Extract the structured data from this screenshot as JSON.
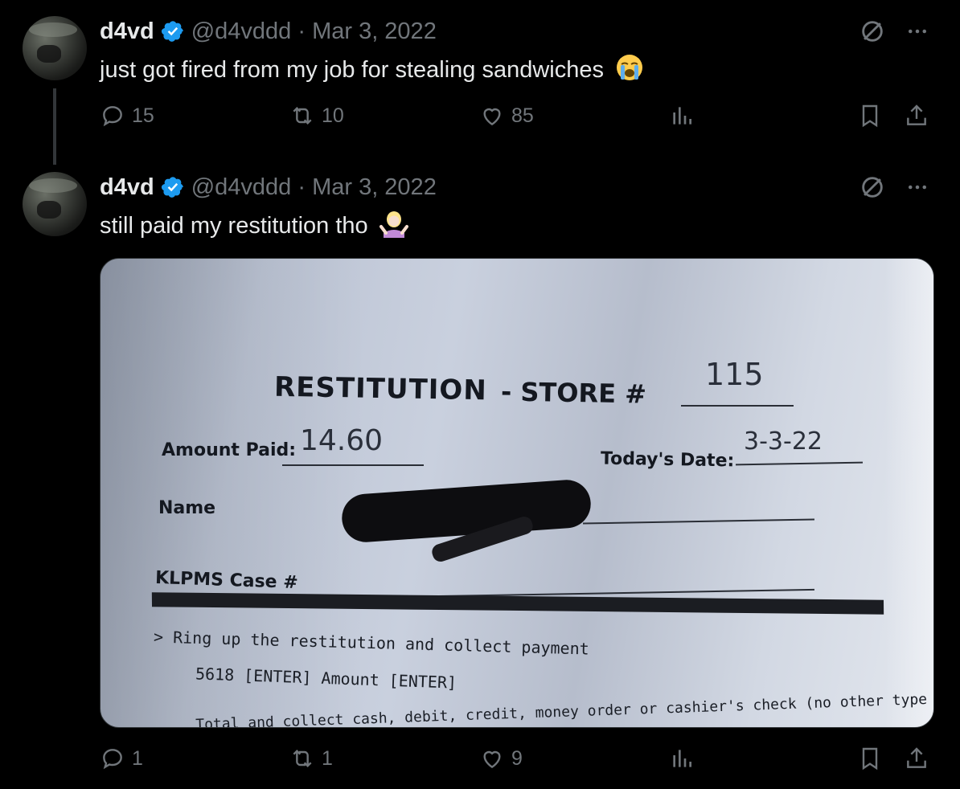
{
  "tweets": [
    {
      "author": {
        "name": "d4vd",
        "handle": "@d4vddd",
        "date": "Mar 3, 2022"
      },
      "text": "just got fired from my job for stealing sandwiches",
      "emoji": "loudly-crying-face",
      "stats": {
        "replies": "15",
        "reposts": "10",
        "likes": "85"
      }
    },
    {
      "author": {
        "name": "d4vd",
        "handle": "@d4vddd",
        "date": "Mar 3, 2022"
      },
      "text": "still paid my restitution tho",
      "emoji": "person-shrugging",
      "stats": {
        "replies": "1",
        "reposts": "1",
        "likes": "9"
      },
      "photo": {
        "form_title": "RESTITUTION",
        "store_label": "- STORE #",
        "store_value": "115",
        "amount_label": "Amount Paid:",
        "amount_value": "14.60",
        "date_label": "Today's Date:",
        "date_value": "3-3-22",
        "name_label": "Name",
        "case_label": "KLPMS Case #",
        "instruction_1": "> Ring up the restitution and collect payment",
        "instruction_2": "5618 [ENTER] Amount [ENTER]",
        "instruction_3": "Total and collect cash, debit, credit, money order or cashier's check (no other type of check)"
      }
    }
  ],
  "colors": {
    "accent": "#1d9bf0",
    "muted": "#71767b",
    "text": "#e7e9ea",
    "background": "#000000"
  }
}
